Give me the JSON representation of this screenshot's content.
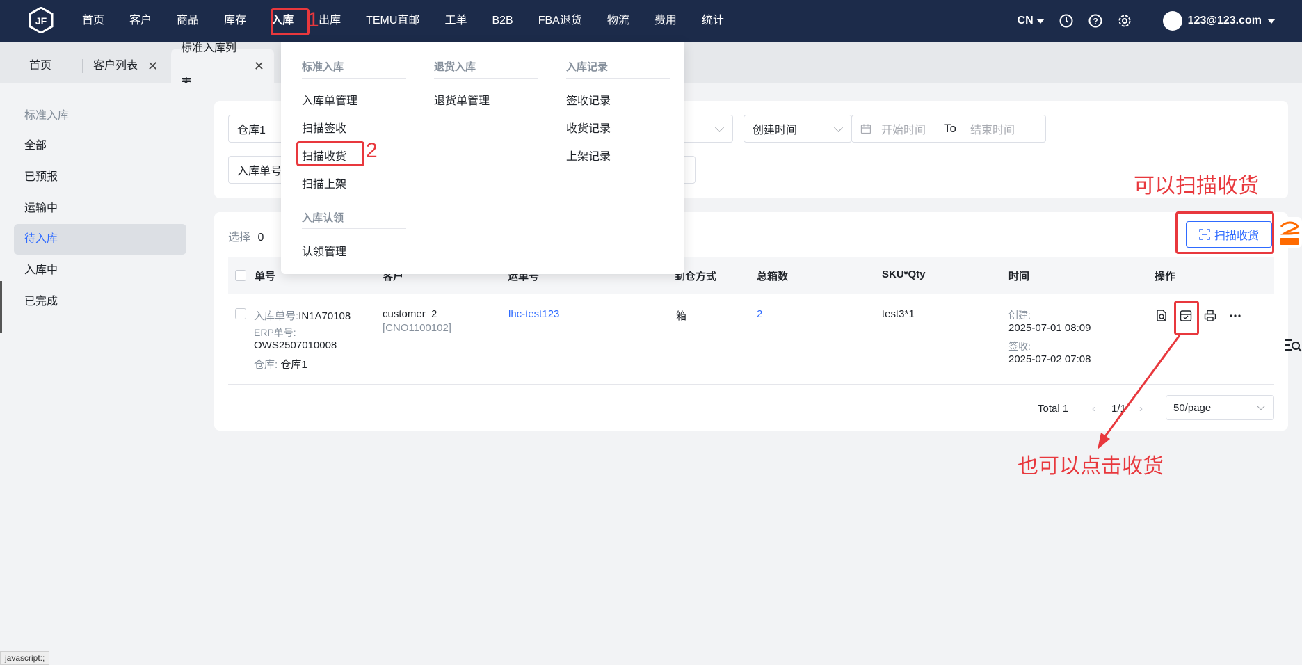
{
  "nav": {
    "items": [
      "首页",
      "客户",
      "商品",
      "库存",
      "入库",
      "出库",
      "TEMU直邮",
      "工单",
      "B2B",
      "FBA退货",
      "物流",
      "费用",
      "统计"
    ],
    "active_index": 4,
    "lang": "CN",
    "user_email": "123@123.com"
  },
  "tabs": [
    {
      "label": "首页"
    },
    {
      "label": "客户列表"
    },
    {
      "label": "标准入库列表"
    }
  ],
  "sidebar": {
    "heading": "标准入库",
    "items": [
      "全部",
      "已预报",
      "运输中",
      "待入库",
      "入库中",
      "已完成"
    ],
    "active_index": 3
  },
  "filters": {
    "warehouse": "仓库1",
    "order_no_label": "入库单号",
    "time_type": "创建时间",
    "start_placeholder": "开始时间",
    "to": "To",
    "end_placeholder": "结束时间"
  },
  "toolbar": {
    "select_label": "选择",
    "select_count": "0",
    "scan_button": "扫描收货"
  },
  "table": {
    "headers": [
      "单号",
      "客户",
      "运单号",
      "到仓方式",
      "总箱数",
      "SKU*Qty",
      "时间",
      "操作"
    ],
    "row": {
      "order_label": "入库单号:",
      "order_no": "IN1A70108",
      "erp_label": "ERP单号:",
      "erp_no": "OWS2507010008",
      "warehouse_label": "仓库:",
      "warehouse": "仓库1",
      "customer": "customer_2",
      "customer_code": "[CNO1100102]",
      "tracking": "lhc-test123",
      "arrival_mode": "箱",
      "boxes": "2",
      "sku_qty": "test3*1",
      "created_label": "创建:",
      "created": "2025-07-01 08:09",
      "signed_label": "签收:",
      "signed": "2025-07-02 07:08"
    }
  },
  "pager": {
    "total": "Total 1",
    "page": "1/1",
    "page_size": "50/page"
  },
  "dropdown": {
    "columns": [
      {
        "heading": "标准入库",
        "items": [
          "入库单管理",
          "扫描签收",
          "扫描收货",
          "扫描上架"
        ]
      },
      {
        "heading": "退货入库",
        "items": [
          "退货单管理"
        ]
      },
      {
        "heading": "入库记录",
        "items": [
          "签收记录",
          "收货记录",
          "上架记录"
        ]
      }
    ],
    "section2": {
      "heading": "入库认领",
      "items": [
        "认领管理"
      ]
    }
  },
  "annotations": {
    "step1": "1",
    "step2": "2",
    "note_scan": "可以扫描收货",
    "note_click": "也可以点击收货"
  },
  "status_bar": "javascript:;",
  "colors": {
    "nav_bg": "#1c2b4a",
    "accent": "#2f6bff",
    "annotation_red": "#e8383d"
  }
}
